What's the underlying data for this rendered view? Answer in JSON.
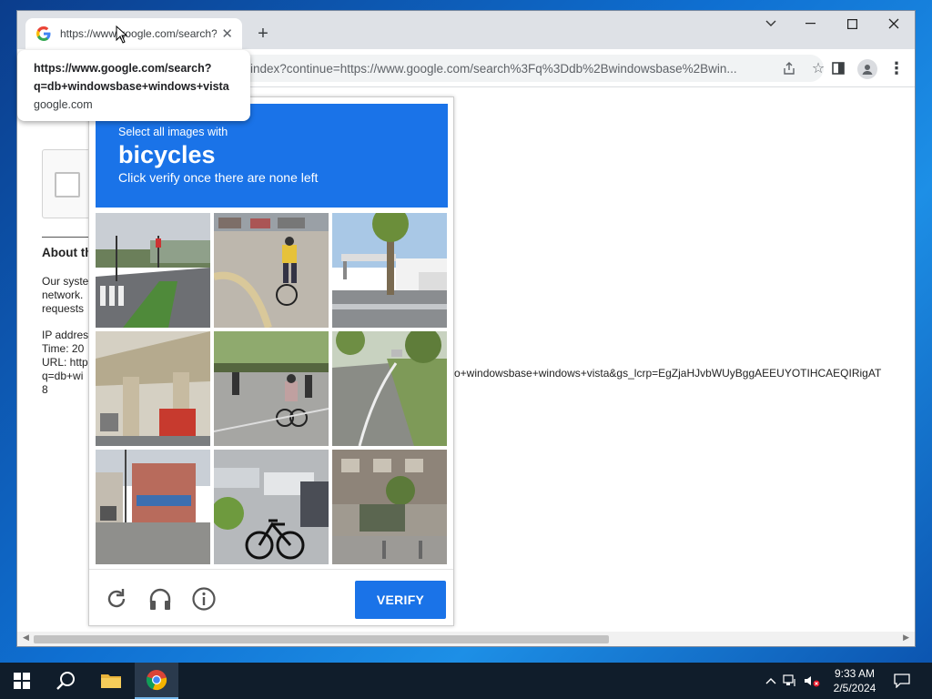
{
  "browser": {
    "tab": {
      "title": "https://www.google.com/search?q=db+windowsbase+windows+vista",
      "favicon": "google-g-icon"
    },
    "address_bar": {
      "url": "index?continue=https://www.google.com/search%3Fq%3Ddb%2Bwindowsbase%2Bwin..."
    },
    "tooltip": {
      "url_line1": "https://www.google.com/search?",
      "url_line2": "q=db+windowsbase+windows+vista",
      "domain": "google.com"
    }
  },
  "page": {
    "about_heading": "About th",
    "text_lines": [
      "Our syste",
      "network.",
      "requests"
    ],
    "info_lines": [
      "IP addres",
      "Time: 20",
      "URL: http",
      "q=db+wi",
      "8"
    ],
    "url_tail": "o+windowsbase+windows+vista&gs_lcrp=EgZjaHJvbWUyBggAEEUYOTIHCAEQIRigAT"
  },
  "captcha": {
    "instruction": "Select all images with",
    "target": "bicycles",
    "note": "Click verify once there are none left",
    "verify_label": "VERIFY",
    "tiles": [
      "street-crosswalk",
      "cyclist-on-bike-path",
      "gas-station-trucks",
      "elevated-railway",
      "cyclist-in-street",
      "road-with-trees",
      "city-street-shops",
      "parked-bicycle",
      "building-with-trees"
    ],
    "accent_color": "#1a73e8"
  },
  "taskbar": {
    "time": "9:33 AM",
    "date": "2/5/2024",
    "apps": [
      "windows-start-icon",
      "search-icon",
      "file-explorer-icon",
      "chrome-icon"
    ]
  }
}
